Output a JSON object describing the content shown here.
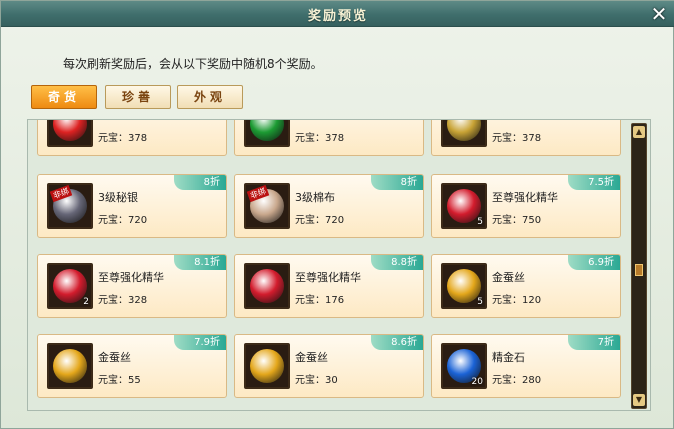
{
  "window": {
    "title": "奖励预览",
    "close_icon": "close-icon"
  },
  "description": "每次刷新奖励后，会从以下奖励中随机8个奖励。",
  "tabs": [
    {
      "label": "奇货",
      "active": true
    },
    {
      "label": "珍善",
      "active": false
    },
    {
      "label": "外观",
      "active": false
    }
  ],
  "price_label": "元宝：",
  "rows": [
    [
      {
        "name": "",
        "price": "378",
        "discount": "",
        "icon": "red-gem-icon",
        "color": "#d22"
      },
      {
        "name": "",
        "price": "378",
        "discount": "",
        "icon": "green-gem-icon",
        "color": "#1c9b33"
      },
      {
        "name": "",
        "price": "378",
        "discount": "",
        "icon": "gold-gem-icon",
        "color": "#c8a335"
      }
    ],
    [
      {
        "name": "3级秘银",
        "price": "720",
        "discount": "8折",
        "icon": "silver-ore-icon",
        "color": "#667",
        "tag": "非绑"
      },
      {
        "name": "3级棉布",
        "price": "720",
        "discount": "8折",
        "icon": "cloth-icon",
        "color": "#c9a88d",
        "tag": "非绑"
      },
      {
        "name": "至尊强化精华",
        "price": "750",
        "discount": "7.5折",
        "icon": "zunqh-icon",
        "color": "#d31c2d",
        "count": "5"
      }
    ],
    [
      {
        "name": "至尊强化精华",
        "price": "328",
        "discount": "8.1折",
        "icon": "zunqh-icon",
        "color": "#d31c2d",
        "count": "2"
      },
      {
        "name": "至尊强化精华",
        "price": "176",
        "discount": "8.8折",
        "icon": "zunqh-icon",
        "color": "#d31c2d"
      },
      {
        "name": "金蚕丝",
        "price": "120",
        "discount": "6.9折",
        "icon": "silk-icon",
        "color": "#e4a71b",
        "count": "5"
      }
    ],
    [
      {
        "name": "金蚕丝",
        "price": "55",
        "discount": "7.9折",
        "icon": "silk-icon",
        "color": "#e4a71b"
      },
      {
        "name": "金蚕丝",
        "price": "30",
        "discount": "8.6折",
        "icon": "silk-icon",
        "color": "#e4a71b"
      },
      {
        "name": "精金石",
        "price": "280",
        "discount": "7折",
        "icon": "blue-crystal-icon",
        "color": "#1b63d6",
        "count": "20"
      }
    ]
  ]
}
